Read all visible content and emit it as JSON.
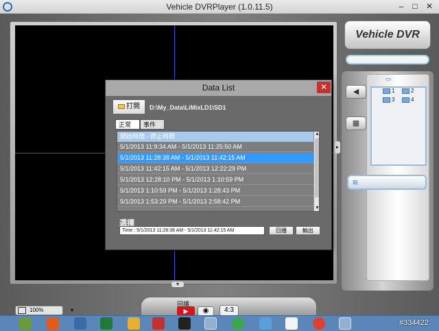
{
  "window": {
    "title": "Vehicle DVRPlayer (1.0.11.5)",
    "min": "–",
    "max": "□",
    "close": "✕"
  },
  "brand": "Vehicle DVR",
  "camera_grid": {
    "labels": [
      "1",
      "2",
      "3",
      "4"
    ]
  },
  "controls": {
    "play_label": "回播",
    "play_icon": "▶",
    "snapshot_icon": "◉",
    "ratio": "4:3",
    "zoom": "100%",
    "zoom_caret": "▾",
    "collapse_arrow": "▾",
    "side_arrow": "▸"
  },
  "dialog": {
    "title": "Data List",
    "close": "✕",
    "open_button": "打開",
    "path": "D:\\My_Data\\LiMixLD1\\SD1",
    "tabs": [
      "正常",
      "事件"
    ],
    "list_header": "開始時間 - 停止時間",
    "rows": [
      "5/1/2013 11:9:34 AM  -  5/1/2013 11:25:50 AM",
      "5/1/2013 11:28:38 AM  -  5/1/2013 11:42:15 AM",
      "5/1/2013 11:42:15 AM  -  5/1/2013 12:22:29 PM",
      "5/1/2013 12:28:10 PM  -  5/1/2013 1:10:59 PM",
      "5/1/2013 1:10:59 PM  -  5/1/2013 1:28:43 PM",
      "5/1/2013 1:53:29 PM  -  5/1/2013 2:58:42 PM"
    ],
    "selected_index": 1,
    "select_label": "選擇",
    "time_value": "Time : 5/1/2013 11:28:38 AM  -  5/1/2013 11:42:15 AM",
    "play_button": "回播",
    "export_button": "輸出"
  },
  "watermark": "#334422"
}
